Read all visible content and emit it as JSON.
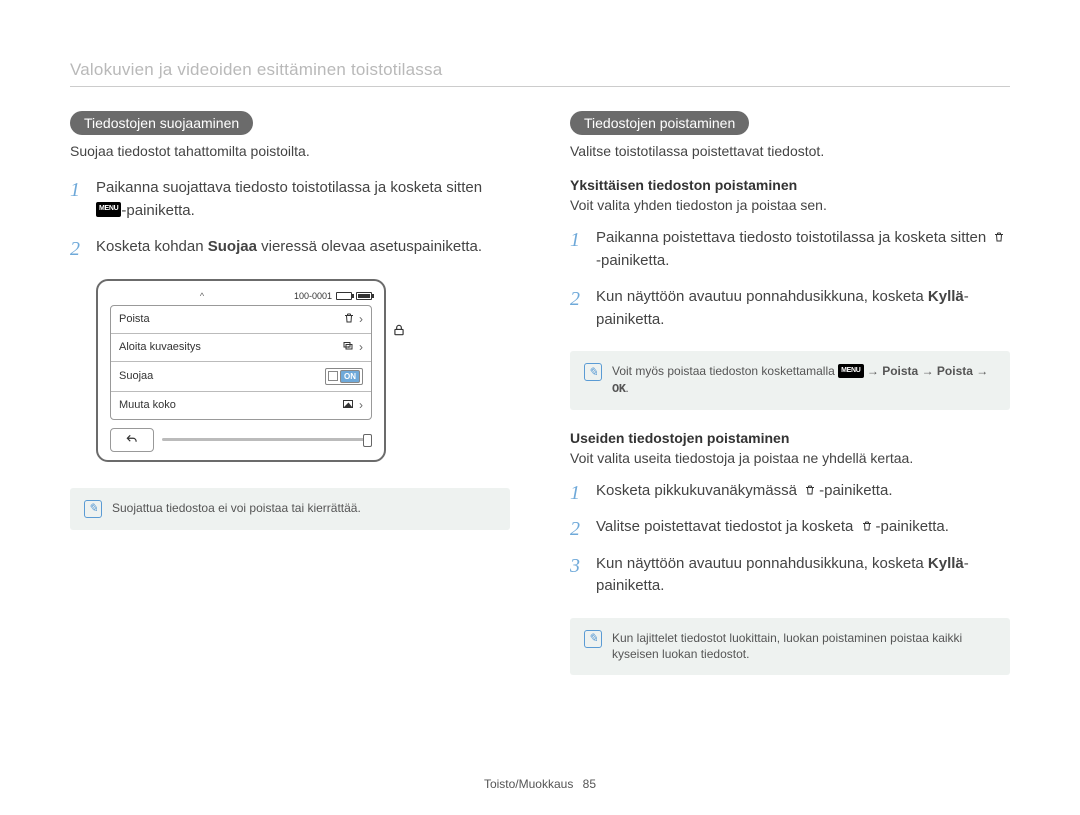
{
  "header": "Valokuvien ja videoiden esittäminen toistotilassa",
  "left": {
    "pill": "Tiedostojen suojaaminen",
    "intro": "Suojaa tiedostot tahattomilta poistoilta.",
    "step1a": "Paikanna suojattava tiedosto toistotilassa ja kosketa sitten ",
    "step1b": "-painiketta.",
    "step2a": "Kosketa kohdan ",
    "step2bold": "Suojaa",
    "step2b": " vieressä olevaa asetuspainiketta.",
    "device": {
      "topchevron": "^",
      "filecode": "100-0001",
      "rows": {
        "delete": "Poista",
        "slideshow": "Aloita kuvaesitys",
        "protect": "Suojaa",
        "resize": "Muuta koko",
        "on": "ON"
      }
    },
    "note": "Suojattua tiedostoa ei voi poistaa tai kierrättää."
  },
  "right": {
    "pill": "Tiedostojen poistaminen",
    "intro": "Valitse toistotilassa poistettavat tiedostot.",
    "single": {
      "head": "Yksittäisen tiedoston poistaminen",
      "sub": "Voit valita yhden tiedoston ja poistaa sen.",
      "step1a": "Paikanna poistettava tiedosto toistotilassa ja kosketa sitten ",
      "step1b": "-painiketta.",
      "step2a": "Kun näyttöön avautuu ponnahdusikkuna, kosketa ",
      "step2bold": "Kyllä",
      "step2b": "-painiketta.",
      "note_a": "Voit myös poistaa tiedoston koskettamalla ",
      "note_b": " → ",
      "note_c": "Poista",
      "note_d": " → ",
      "note_e": "Poista",
      "note_f": " → ",
      "note_g": "OK",
      "note_end": "."
    },
    "multi": {
      "head": "Useiden tiedostojen poistaminen",
      "sub": "Voit valita useita tiedostoja ja poistaa ne yhdellä kertaa.",
      "step1a": "Kosketa pikkukuvanäkymässä ",
      "step1b": "-painiketta.",
      "step2a": "Valitse poistettavat tiedostot ja kosketa ",
      "step2b": "-painiketta.",
      "step3a": "Kun näyttöön avautuu ponnahdusikkuna, kosketa ",
      "step3bold": "Kyllä",
      "step3b": "-painiketta.",
      "note": "Kun lajittelet tiedostot luokittain, luokan poistaminen poistaa kaikki kyseisen luokan tiedostot."
    }
  },
  "footer": {
    "section": "Toisto/Muokkaus",
    "page": "85"
  }
}
